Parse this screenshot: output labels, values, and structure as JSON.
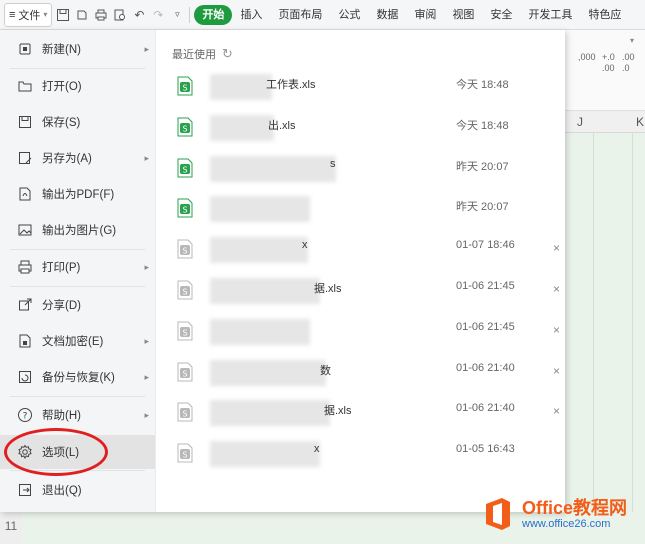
{
  "toolbar": {
    "file_label": "文件",
    "tabs": [
      "开始",
      "插入",
      "页面布局",
      "公式",
      "数据",
      "审阅",
      "视图",
      "安全",
      "开发工具",
      "特色应"
    ]
  },
  "sheet": {
    "col_headers": [
      "J",
      "K"
    ],
    "row_number": "11",
    "number_formats": [
      ",000",
      ".00",
      "+.0",
      ".00",
      ".0"
    ]
  },
  "file_menu": {
    "items": [
      {
        "label": "新建(N)",
        "icon": "new-icon",
        "has_arrow": true
      },
      {
        "label": "打开(O)",
        "icon": "folder-icon",
        "has_arrow": false
      },
      {
        "label": "保存(S)",
        "icon": "save-icon",
        "has_arrow": false
      },
      {
        "label": "另存为(A)",
        "icon": "save-as-icon",
        "has_arrow": true
      },
      {
        "label": "输出为PDF(F)",
        "icon": "pdf-icon",
        "has_arrow": false
      },
      {
        "label": "输出为图片(G)",
        "icon": "image-icon",
        "has_arrow": false
      },
      {
        "label": "打印(P)",
        "icon": "print-icon",
        "has_arrow": true
      },
      {
        "label": "分享(D)",
        "icon": "share-icon",
        "has_arrow": false
      },
      {
        "label": "文档加密(E)",
        "icon": "lock-doc-icon",
        "has_arrow": true
      },
      {
        "label": "备份与恢复(K)",
        "icon": "backup-icon",
        "has_arrow": true
      },
      {
        "label": "帮助(H)",
        "icon": "help-icon",
        "has_arrow": true
      },
      {
        "label": "选项(L)",
        "icon": "gear-icon",
        "has_arrow": false
      },
      {
        "label": "退出(Q)",
        "icon": "exit-icon",
        "has_arrow": false
      }
    ],
    "recent_title": "最近使用",
    "recent_files": [
      {
        "name": "工作表.xls",
        "time": "今天 18:48",
        "closable": false
      },
      {
        "name": "出.xls",
        "time": "今天 18:48",
        "closable": false
      },
      {
        "name": "s",
        "time": "昨天 20:07",
        "closable": false
      },
      {
        "name": "",
        "time": "昨天 20:07",
        "closable": false
      },
      {
        "name": "x",
        "time": "01-07 18:46",
        "closable": true
      },
      {
        "name": "据.xls",
        "time": "01-06 21:45",
        "closable": true
      },
      {
        "name": "",
        "time": "01-06 21:45",
        "closable": true
      },
      {
        "name": "数",
        "time": "01-06 21:40",
        "closable": true
      },
      {
        "name": "据.xls",
        "time": "01-06 21:40",
        "closable": true
      },
      {
        "name": "x",
        "time": "01-05 16:43",
        "closable": false
      }
    ]
  },
  "watermark": {
    "title": "Office教程网",
    "url": "www.office26.com"
  },
  "colors": {
    "accent": "#1e9b3e",
    "annotation": "#e02020",
    "watermark_orange": "#f25d1a",
    "watermark_blue": "#2a6fc9"
  }
}
